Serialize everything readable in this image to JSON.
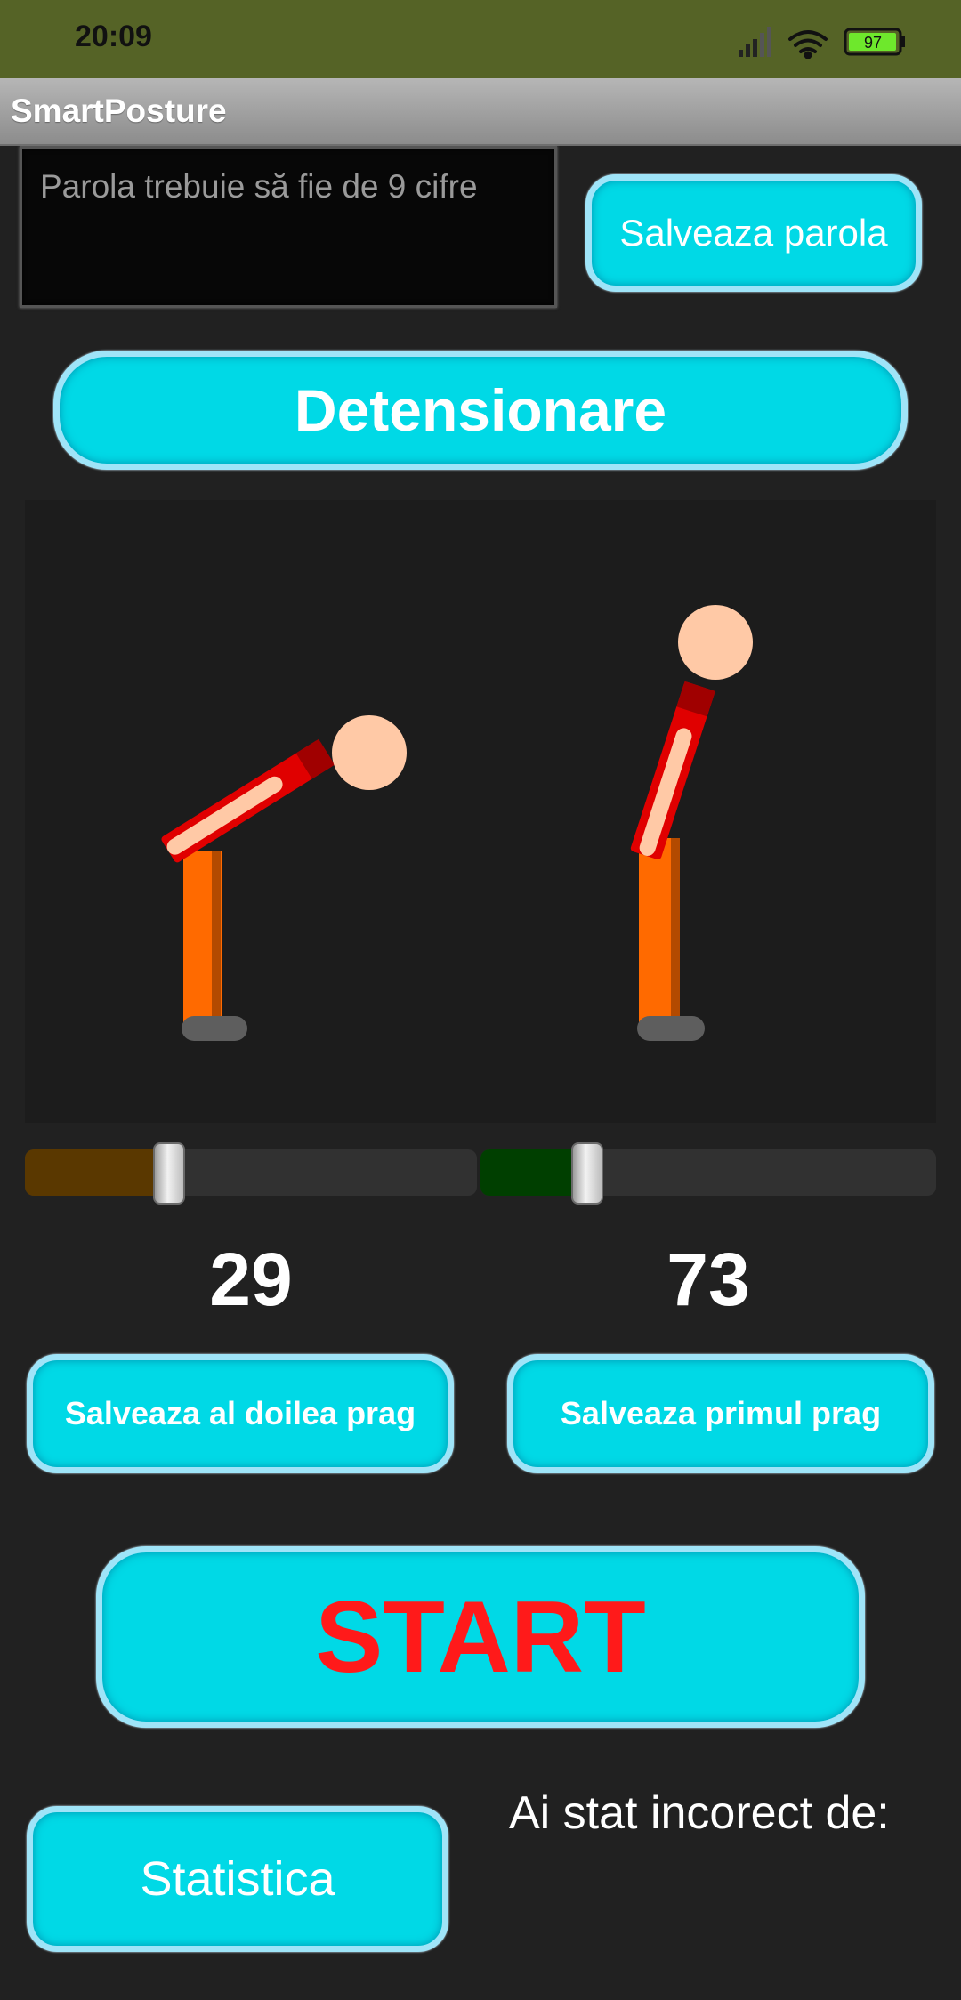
{
  "status_bar": {
    "time": "20:09",
    "battery": "97"
  },
  "app": {
    "title": "SmartPosture"
  },
  "password": {
    "placeholder": "Parola trebuie să fie de 9 cifre",
    "save_label": "Salveaza parola"
  },
  "mode_button": {
    "label": "Detensionare"
  },
  "sliders": {
    "second_threshold": {
      "value": 29,
      "fill_color": "#5a3800"
    },
    "first_threshold": {
      "value": 73,
      "fill_color": "#003f00"
    }
  },
  "threshold_buttons": {
    "second": "Salveaza al doilea prag",
    "first": "Salveaza primul prag"
  },
  "start_button": {
    "label": "START",
    "color": "#ff1a1a"
  },
  "stats_button": {
    "label": "Statistica"
  },
  "incorrect_label": "Ai stat incorect de:",
  "colors": {
    "accent": "#00d9e6",
    "accent_border": "#9fe4f8",
    "shirt": "#e00000",
    "legs": "#ff6a00",
    "skin": "#ffc9a6"
  }
}
